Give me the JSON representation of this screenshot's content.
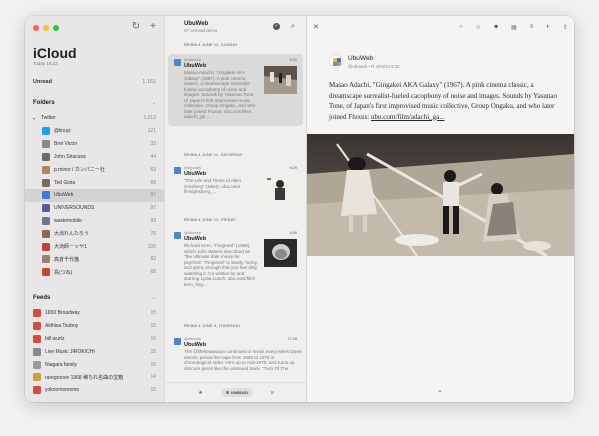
{
  "sidebar": {
    "refresh_icon": "↻",
    "add_icon": "+",
    "account_title": "iCloud",
    "account_subtitle": "Today 19:22",
    "unread_label": "Unread",
    "unread_count": "1,161",
    "folders_label": "Folders",
    "twitter_label": "Twitter",
    "twitter_count": "1,013",
    "feeds_label": "Feeds",
    "twitter_feeds": [
      {
        "label": "@linuyi",
        "count": "121",
        "color": "#1da1f2"
      },
      {
        "label": "Bret Victor",
        "count": "32",
        "color": "#888888"
      },
      {
        "label": "John Siracusa",
        "count": "44",
        "color": "#6b6b6b"
      },
      {
        "label": "p.minor / カンパニー社",
        "count": "63",
        "color": "#b08858"
      },
      {
        "label": "Ted Gioia",
        "count": "69",
        "color": "#7a6a5a"
      },
      {
        "label": "UbuWeb",
        "count": "97",
        "color": "#3c7bd6"
      },
      {
        "label": "UNIVERSOUNDS",
        "count": "97",
        "color": "#5a5aa0"
      },
      {
        "label": "wastemobile",
        "count": "93",
        "color": "#6b7b8b"
      },
      {
        "label": "大滝れんたろう",
        "count": "76",
        "color": "#8a6a4a"
      },
      {
        "label": "大滝師ーッヤ1",
        "count": "100",
        "color": "#c04040"
      },
      {
        "label": "高倉千代猫",
        "count": "82",
        "color": "#a08070"
      },
      {
        "label": "鳥(つね)",
        "count": "68",
        "color": "#c04a30"
      }
    ],
    "feeds": [
      {
        "label": "1650 Broadway",
        "count": "15",
        "color": "#d94a3a"
      },
      {
        "label": "Akihisa Tsuboy",
        "count": "15",
        "color": "#d94a3a"
      },
      {
        "label": "bill wurtz",
        "count": "15",
        "color": "#d94a3a"
      },
      {
        "label": "Live Music JIROKICHI",
        "count": "15",
        "color": "#888888"
      },
      {
        "label": "Niagara family",
        "count": "15",
        "color": "#999999"
      },
      {
        "label": "raregroove 1968 稀ちれ名曲の宝箱",
        "count": "14",
        "color": "#c8a040"
      },
      {
        "label": "yokoomomemo",
        "count": "15",
        "color": "#d94a3a"
      }
    ]
  },
  "middle": {
    "title": "UbuWeb",
    "subtitle": "97 Unread Items",
    "check_icon": "✓",
    "search_icon": "⌕",
    "day_headers": [
      "REIWA 4 JUNE 12, SUNDAY",
      "REIWA 4 JUNE 11, SATURDAY",
      "REIWA 4 JUNE 10, FRIDAY",
      "REIWA 4 JUNE 9, THURSDAY"
    ],
    "cards": [
      {
        "meta": "@ubuweb",
        "time": "6:32",
        "title": "UbuWeb",
        "summary": "Masao Adachi, \"Gingakei AKA Galaxy\" (1967). A pink cinema classic, a dreamscape surrealist-fueled cacophony of noise and images. Sounds by Yasunao Tone, of Japan's first improvised music collective, Group Ongaku, and who later joined Fluxus: ubu.com/film/ adachi_ga..."
      },
      {
        "meta": "@ubuweb",
        "time": "8:29",
        "title": "UbuWeb",
        "summary": "\"The Life and Times of Allen Ginsberg\" (1994): ubu.com/ film/ginsberg_..."
      },
      {
        "meta": "@ubuweb",
        "time": "6:58",
        "title": "UbuWeb",
        "summary": "Richard Kern, \"Fingered\" (1986), which John Waters described as \"the ultimate date movie for psychos\" \"Fingered\" is seedy, horny, and grimy enough that you feel dirty watching it. Co-written by and starring Lydia Lunch: ubu.com/film/ kern_fing..."
      },
      {
        "meta": "@ubuweb",
        "time": "17:28",
        "title": "UbuWeb",
        "summary": "The @lifeheatwarpo continues to revisit every Miles Davis electric period live tape from 1969 to 1975 in chronological order. He's up to mid-1970, and turns up obscure gems like the unissued track, \"Turn Of The"
      }
    ],
    "footer_star": "★",
    "footer_unread": "UNREAD",
    "footer_filter": "≡"
  },
  "reader": {
    "close_icon": "✕",
    "toolbar_icons": [
      "○",
      "☆",
      "⬥",
      "▤",
      "≡",
      "◐",
      "⇪"
    ],
    "feed_name": "UbuWeb",
    "author_line": "@ubuweb • R 4/06/12 6:32",
    "body_text": "Masao Adachi, \"Gingakei AKA Galaxy\" (1967). A pink cinema classic, a dreamscape surrealist-fueled cacophony of noise and images. Sounds by Yasunao Tone, of Japan's first improvised music collective, Group Ongaku, and who later joined Fluxus: ",
    "body_link": "ubu.com/film/adachi_ga...",
    "down_icon": "⌄"
  }
}
